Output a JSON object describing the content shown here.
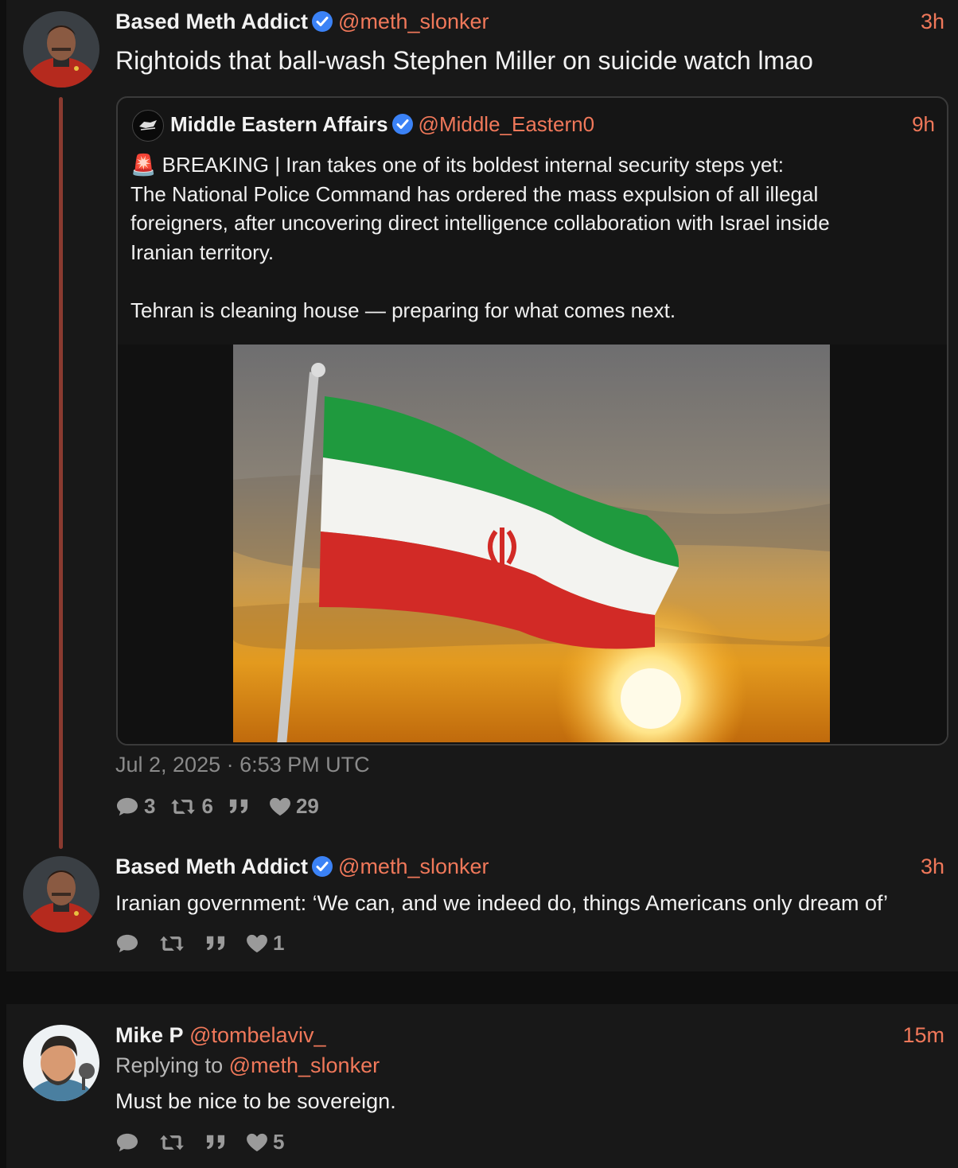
{
  "colors": {
    "accent": "#f0785a",
    "verified": "#3b82f6",
    "thread_line": "#8a3a30"
  },
  "post1": {
    "name": "Based Meth Addict",
    "handle": "@meth_slonker",
    "time": "3h",
    "text": "Rightoids that ball-wash Stephen Miller on suicide watch lmao",
    "quote": {
      "name": "Middle Eastern Affairs",
      "handle": "@Middle_Eastern0",
      "time": "9h",
      "line1": "🚨 BREAKING | Iran takes one of its boldest internal security steps yet:",
      "line2": "The National Police Command has ordered the mass expulsion of all illegal",
      "line3": "foreigners, after uncovering direct intelligence collaboration with Israel inside",
      "line4": "Iranian territory.",
      "line5": "Tehran is cleaning house — preparing for what comes next."
    },
    "date": "Jul 2, 2025 · 6:53 PM UTC",
    "stats": {
      "replies": "3",
      "reposts": "6",
      "quotes": "",
      "likes": "29"
    }
  },
  "post2": {
    "name": "Based Meth Addict",
    "handle": "@meth_slonker",
    "time": "3h",
    "text": "Iranian government: ‘We can, and we indeed do, things Americans only dream of’",
    "stats": {
      "replies": "",
      "reposts": "",
      "quotes": "",
      "likes": "1"
    }
  },
  "post3": {
    "name": "Mike P",
    "handle": "@tombelaviv_",
    "time": "15m",
    "replying_prefix": "Replying to ",
    "replying_handle": "@meth_slonker",
    "text": "Must be nice to be sovereign.",
    "stats": {
      "replies": "",
      "reposts": "",
      "quotes": "",
      "likes": "5"
    }
  }
}
